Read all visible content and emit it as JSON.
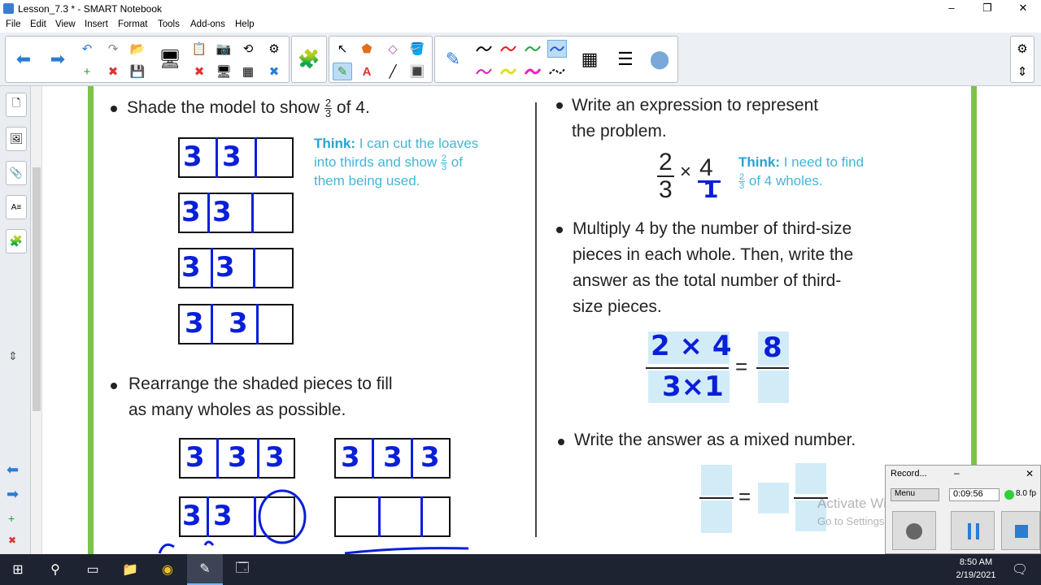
{
  "window": {
    "title": "Lesson_7.3 * - SMART Notebook",
    "min": "–",
    "max": "❐",
    "close": "✕"
  },
  "menu": [
    "File",
    "Edit",
    "View",
    "Insert",
    "Format",
    "Tools",
    "Add-ons",
    "Help"
  ],
  "toolbar": {
    "back": "⬅",
    "forward": "➡",
    "undo": "↶",
    "redo": "↷",
    "open": "📂",
    "new_page": "+",
    "delete_page": "✖",
    "save": "💾",
    "screen": "🖥",
    "paste": "📋",
    "screenshot": "📷",
    "undo2": "⟲",
    "settings": "⚙",
    "add_on": "🧩",
    "select": "↖",
    "shapes": "⬟",
    "eraser": "◇",
    "fill": "🪣",
    "pens": "✎",
    "text": "A",
    "line": "╱",
    "magic": "🔳",
    "color_picker": "▦",
    "properties": "☰",
    "more": "⬤",
    "gear": "⚙",
    "move": "⇕"
  },
  "sidetabs": [
    "🗋",
    "🖼",
    "📎",
    "A≡",
    "🧩"
  ],
  "left": {
    "q1": "Shade the model to show",
    "q1_frac_n": "2",
    "q1_frac_d": "3",
    "q1_tail": "of 4.",
    "think1_label": "Think:",
    "think1_l1": "I can cut the loaves",
    "think1_l2": "into thirds and show",
    "think1_frac_n": "2",
    "think1_frac_d": "3",
    "think1_l2b": "of",
    "think1_l3": "them being used.",
    "q2_l1": "Rearrange the shaded pieces to fill",
    "q2_l2": "as many wholes as possible.",
    "hw": [
      "3",
      "3",
      "3",
      "3",
      "3",
      "3",
      "3",
      "3",
      "3",
      "3",
      "3",
      "3",
      "3",
      "3",
      "3"
    ]
  },
  "right": {
    "q3_l1": "Write an expression to represent",
    "q3_l2": "the problem.",
    "expr_n": "2",
    "expr_d": "3",
    "times": "×",
    "four": "4",
    "hand_one": "1",
    "think2_label": "Think:",
    "think2_l1": "I need to find",
    "think2_frac_n": "2",
    "think2_frac_d": "3",
    "think2_l2": "of 4 wholes.",
    "q4_l1": "Multiply 4 by the number of third-size",
    "q4_l2": "pieces in each whole. Then, write the",
    "q4_l3": "answer as the total number of third-",
    "q4_l4": "size pieces.",
    "calc_top": "2 × 4",
    "calc_bot": "3×1",
    "equals": "=",
    "result": "8",
    "q5": "Write the answer as a mixed number.",
    "equals2": "="
  },
  "recorder": {
    "title": "Record...",
    "menu": "Menu",
    "time": "0:09:56",
    "fps": "8.0 fp"
  },
  "watermark": {
    "l1": "Activate Windows",
    "l2": "Go to Settings to activate Windows."
  },
  "taskbar": {
    "start": "⊞",
    "search": "⚲",
    "taskview": "▭",
    "explorer": "📁",
    "chrome": "◉",
    "notebook": "✎",
    "app": "🗔",
    "time": "8:50 AM",
    "date": "2/19/2021",
    "notify": "🗨"
  }
}
